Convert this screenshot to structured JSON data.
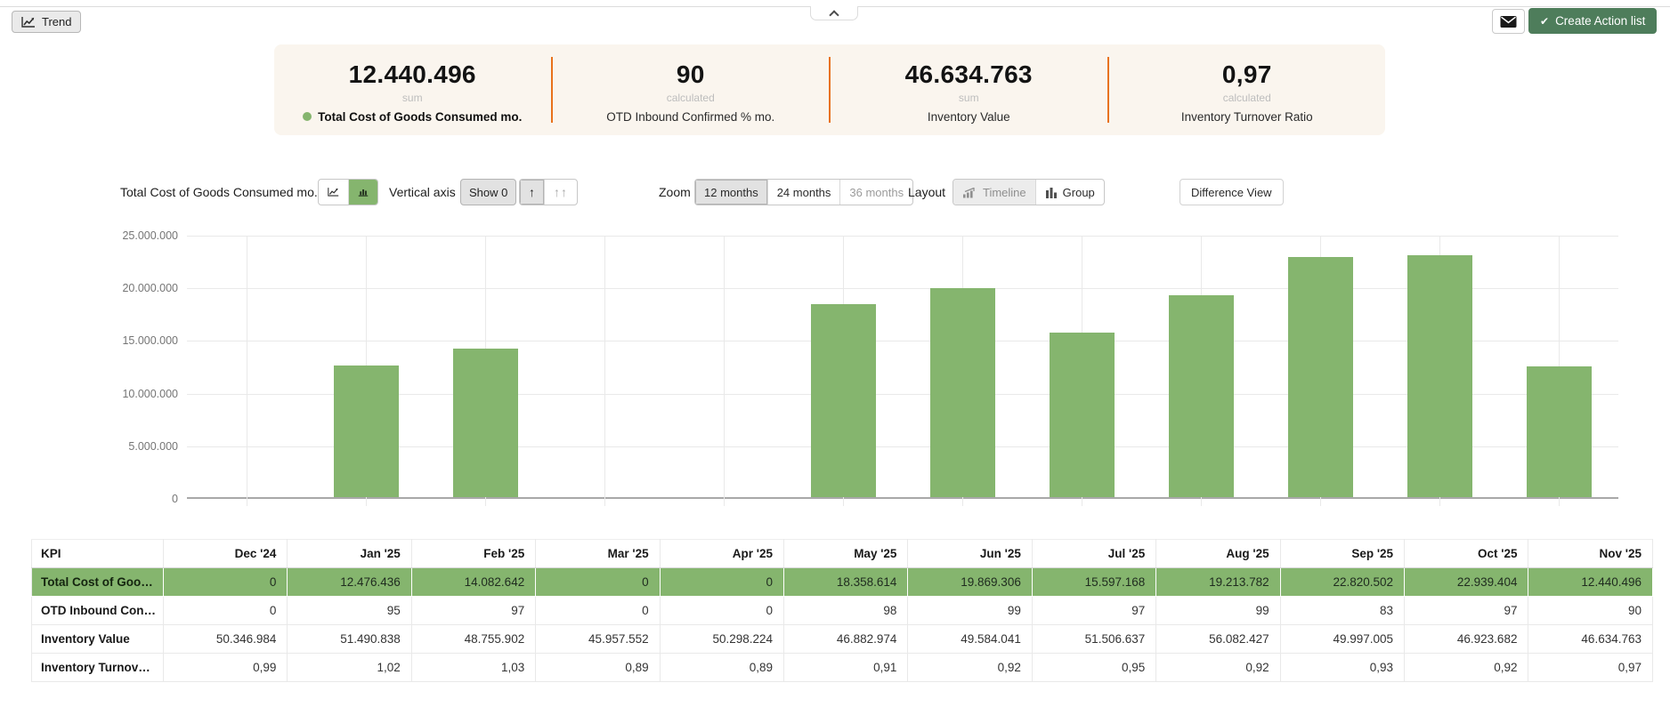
{
  "colors": {
    "accent_green": "#85b56e",
    "action_button_green": "#4e7d5b",
    "kpi_band_background": "#faf5ee",
    "kpi_divider_orange": "#e8721c"
  },
  "topbar": {
    "trend_label": "Trend",
    "create_action_label": "Create Action list",
    "check_icon": "✔"
  },
  "kpis": [
    {
      "value": "12.440.496",
      "method": "sum",
      "name": "Total Cost of Goods Consumed mo."
    },
    {
      "value": "90",
      "method": "calculated",
      "name": "OTD Inbound Confirmed % mo."
    },
    {
      "value": "46.634.763",
      "method": "sum",
      "name": "Inventory Value"
    },
    {
      "value": "0,97",
      "method": "calculated",
      "name": "Inventory Turnover Ratio"
    }
  ],
  "controls": {
    "series_label": "Total Cost of Goods Consumed mo.",
    "vertical_axis_label": "Vertical axis",
    "show_zero_label": "Show 0",
    "arrow_single": "↑",
    "arrow_double": "↑↑",
    "zoom_label": "Zoom",
    "zoom_options": [
      "12 months",
      "24 months",
      "36 months"
    ],
    "zoom_selected": "12 months",
    "layout_label": "Layout",
    "layout_options": [
      "Timeline",
      "Group"
    ],
    "difference_view_label": "Difference View"
  },
  "chart_data": {
    "type": "bar",
    "title": "Total Cost of Goods Consumed mo.",
    "categories": [
      "Dec '24",
      "Jan '25",
      "Feb '25",
      "Mar '25",
      "Apr '25",
      "May '25",
      "Jun '25",
      "Jul '25",
      "Aug '25",
      "Sep '25",
      "Oct '25",
      "Nov '25"
    ],
    "values": [
      0,
      12476436,
      14082642,
      0,
      0,
      18358614,
      19869306,
      15597168,
      19213782,
      22820502,
      22939404,
      12440496
    ],
    "ylim": [
      0,
      25000000
    ],
    "ytick_interval": 5000000,
    "ytick_labels": [
      "0",
      "5.000.000",
      "10.000.000",
      "15.000.000",
      "20.000.000",
      "25.000.000"
    ],
    "bar_color": "#85b56e",
    "grid": true,
    "legend": "none",
    "x_axis_labels_visible": false
  },
  "table": {
    "kpi_header": "KPI",
    "columns": [
      "Dec '24",
      "Jan '25",
      "Feb '25",
      "Mar '25",
      "Apr '25",
      "May '25",
      "Jun '25",
      "Jul '25",
      "Aug '25",
      "Sep '25",
      "Oct '25",
      "Nov '25"
    ],
    "rows": [
      {
        "name": "Total Cost of Goods Consumed mo.",
        "highlight": true,
        "values": [
          "0",
          "12.476.436",
          "14.082.642",
          "0",
          "0",
          "18.358.614",
          "19.869.306",
          "15.597.168",
          "19.213.782",
          "22.820.502",
          "22.939.404",
          "12.440.496"
        ]
      },
      {
        "name": "OTD Inbound Confirmed % mo.",
        "highlight": false,
        "values": [
          "0",
          "95",
          "97",
          "0",
          "0",
          "98",
          "99",
          "97",
          "99",
          "83",
          "97",
          "90"
        ]
      },
      {
        "name": "Inventory Value",
        "highlight": false,
        "values": [
          "50.346.984",
          "51.490.838",
          "48.755.902",
          "45.957.552",
          "50.298.224",
          "46.882.974",
          "49.584.041",
          "51.506.637",
          "56.082.427",
          "49.997.005",
          "46.923.682",
          "46.634.763"
        ]
      },
      {
        "name": "Inventory Turnover Ratio",
        "highlight": false,
        "values": [
          "0,99",
          "1,02",
          "1,03",
          "0,89",
          "0,89",
          "0,91",
          "0,92",
          "0,95",
          "0,92",
          "0,93",
          "0,92",
          "0,97"
        ]
      }
    ]
  }
}
